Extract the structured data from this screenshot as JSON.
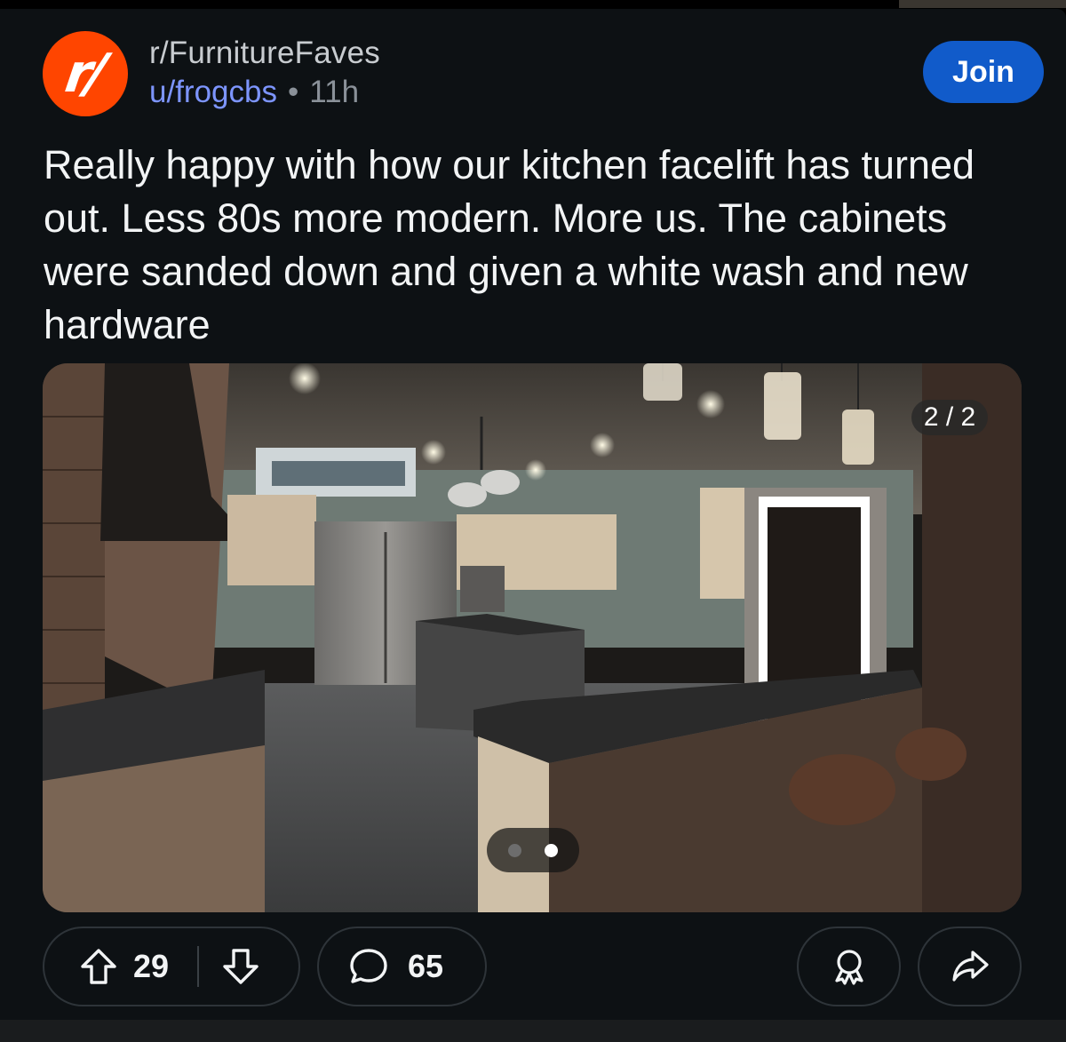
{
  "post": {
    "subreddit": "r/FurnitureFaves",
    "subreddit_icon": "r/",
    "author": "u/frogcbs",
    "separator": "•",
    "time_ago": "11h",
    "join_label": "Join",
    "title": "Really happy with how our kitchen facelift has turned out. Less 80s more modern. More us. The cabinets were sanded down and given a white wash and new hardware"
  },
  "media": {
    "image_description_icon": "kitchen-photo",
    "counter": "2 / 2",
    "page_count": 2,
    "current_page": 2
  },
  "actions": {
    "upvote_icon": "arrow-up-icon",
    "score": "29",
    "downvote_icon": "arrow-down-icon",
    "comment_icon": "speech-bubble-icon",
    "comments": "65",
    "award_icon": "award-icon",
    "share_icon": "share-arrow-icon"
  },
  "colors": {
    "background": "#0d1114",
    "subreddit_icon": "#ff4500",
    "join_button": "#115bca",
    "username": "#7d95ff",
    "text_primary": "#f2f4f5",
    "text_secondary": "#8a9199",
    "pill_border": "#2e3439"
  }
}
